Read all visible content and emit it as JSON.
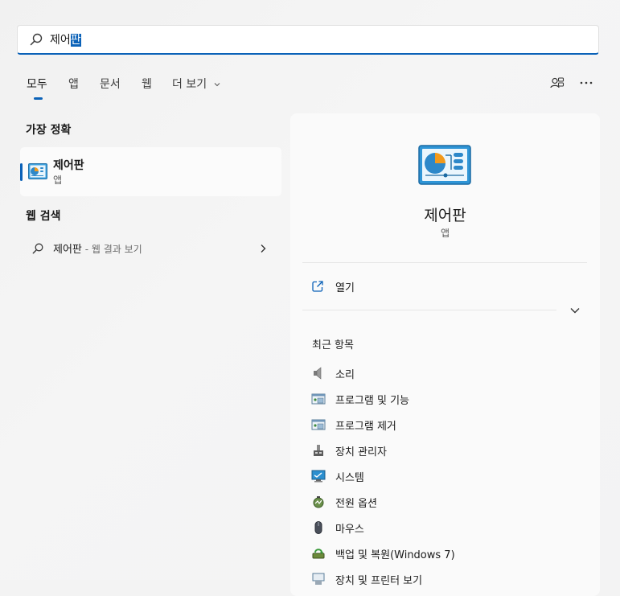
{
  "search": {
    "typed": "제어",
    "selected": "판"
  },
  "tabs": [
    {
      "label": "모두",
      "active": true
    },
    {
      "label": "앱"
    },
    {
      "label": "문서"
    },
    {
      "label": "웹"
    },
    {
      "label": "더 보기"
    }
  ],
  "top_icons": [
    "account-switch-icon",
    "more-options-icon"
  ],
  "best_match": {
    "title": "가장 정확",
    "name": "제어판",
    "kind": "앱",
    "icon": "control-panel-icon"
  },
  "web_search": {
    "title": "웹 검색",
    "query": "제어판",
    "suffix": " - 웹 결과 보기"
  },
  "detail": {
    "name": "제어판",
    "kind": "앱",
    "open_label": "열기",
    "recent_title": "최근 항목",
    "recent_items": [
      {
        "label": "소리",
        "icon": "speaker-icon"
      },
      {
        "label": "프로그램 및 기능",
        "icon": "programs-icon"
      },
      {
        "label": "프로그램 제거",
        "icon": "uninstall-icon"
      },
      {
        "label": "장치 관리자",
        "icon": "device-manager-icon"
      },
      {
        "label": "시스템",
        "icon": "system-icon"
      },
      {
        "label": "전원 옵션",
        "icon": "power-options-icon"
      },
      {
        "label": "마우스",
        "icon": "mouse-icon"
      },
      {
        "label": "백업 및 복원(Windows 7)",
        "icon": "backup-icon"
      },
      {
        "label": "장치 및 프린터 보기",
        "icon": "devices-printers-icon"
      }
    ]
  },
  "colors": {
    "accent": "#0b62b8",
    "background": "#f3f3f3",
    "panel": "#fafafa"
  }
}
